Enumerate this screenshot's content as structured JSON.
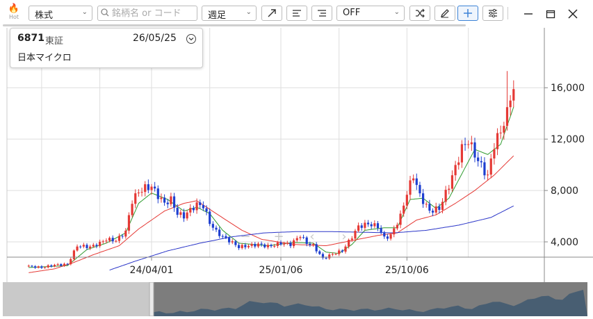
{
  "toolbar": {
    "hot_label": "Hot",
    "market_select": "株式",
    "search_placeholder": "銘柄名 or コード",
    "period_select": "週足",
    "mode_select": "OFF"
  },
  "stock": {
    "code": "6871",
    "exchange": "東証",
    "date": "26/05/25",
    "name": "日本マイクロ"
  },
  "chart_data": {
    "type": "candlestick",
    "title": "",
    "xlabel": "",
    "ylabel": "",
    "ylim": [
      1500,
      17500
    ],
    "y_ticks": [
      4000,
      8000,
      12000,
      16000
    ],
    "y_tick_labels": [
      "4,000",
      "8,000",
      "12,000",
      "16,000"
    ],
    "x_tick_labels": [
      "24/04/01",
      "25/01/06",
      "25/10/06"
    ],
    "x_tick_weeks": [
      0,
      40,
      79
    ],
    "grid": true,
    "up_color": "#e53935",
    "down_color": "#1e3fd0",
    "ma_series": [
      {
        "color": "#2e9b2e"
      },
      {
        "color": "#e53935"
      },
      {
        "color": "#2a35c8"
      }
    ],
    "anchors": [
      [
        -38,
        2100
      ],
      [
        -34,
        2000
      ],
      [
        -30,
        2200
      ],
      [
        -26,
        2250
      ],
      [
        -23,
        3700
      ],
      [
        -19,
        3600
      ],
      [
        -16,
        3900
      ],
      [
        -14,
        4200
      ],
      [
        -11,
        4100
      ],
      [
        -8,
        4800
      ],
      [
        -6,
        7200
      ],
      [
        -4,
        7900
      ],
      [
        -2,
        8200
      ],
      [
        0,
        8300
      ],
      [
        2,
        7600
      ],
      [
        4,
        7000
      ],
      [
        6,
        7300
      ],
      [
        8,
        6200
      ],
      [
        10,
        6000
      ],
      [
        12,
        6500
      ],
      [
        14,
        6900
      ],
      [
        16,
        6800
      ],
      [
        18,
        5500
      ],
      [
        20,
        4800
      ],
      [
        22,
        4400
      ],
      [
        24,
        4100
      ],
      [
        27,
        3600
      ],
      [
        30,
        3700
      ],
      [
        33,
        3800
      ],
      [
        36,
        3650
      ],
      [
        38,
        3750
      ],
      [
        40,
        3900
      ],
      [
        43,
        3800
      ],
      [
        46,
        4500
      ],
      [
        48,
        3900
      ],
      [
        50,
        3700
      ],
      [
        53,
        2700
      ],
      [
        56,
        3050
      ],
      [
        59,
        3300
      ],
      [
        62,
        4400
      ],
      [
        64,
        5200
      ],
      [
        67,
        5400
      ],
      [
        70,
        5200
      ],
      [
        72,
        4300
      ],
      [
        74,
        4500
      ],
      [
        77,
        6000
      ],
      [
        79,
        7800
      ],
      [
        81,
        9200
      ],
      [
        83,
        7600
      ],
      [
        86,
        6400
      ],
      [
        89,
        6600
      ],
      [
        92,
        8400
      ],
      [
        94,
        9800
      ],
      [
        96,
        11300
      ],
      [
        98,
        11900
      ],
      [
        100,
        10800
      ],
      [
        102,
        9900
      ],
      [
        104,
        9100
      ],
      [
        106,
        11600
      ],
      [
        108,
        12600
      ],
      [
        110,
        14000
      ],
      [
        111,
        15400
      ],
      [
        112,
        15900
      ]
    ],
    "ma_short_anchors": [
      [
        -38,
        2000
      ],
      [
        -26,
        2150
      ],
      [
        -20,
        3400
      ],
      [
        -14,
        3900
      ],
      [
        -8,
        4700
      ],
      [
        -4,
        7000
      ],
      [
        0,
        7800
      ],
      [
        5,
        7300
      ],
      [
        10,
        6400
      ],
      [
        14,
        6700
      ],
      [
        18,
        6200
      ],
      [
        22,
        4900
      ],
      [
        27,
        3900
      ],
      [
        36,
        3700
      ],
      [
        44,
        3950
      ],
      [
        50,
        3900
      ],
      [
        54,
        3200
      ],
      [
        58,
        3100
      ],
      [
        62,
        3800
      ],
      [
        66,
        4900
      ],
      [
        72,
        5100
      ],
      [
        76,
        5100
      ],
      [
        80,
        7300
      ],
      [
        84,
        7400
      ],
      [
        88,
        6600
      ],
      [
        92,
        7400
      ],
      [
        96,
        9300
      ],
      [
        100,
        11200
      ],
      [
        104,
        10800
      ],
      [
        108,
        11600
      ],
      [
        112,
        14500
      ]
    ],
    "ma_mid_anchors": [
      [
        -38,
        1600
      ],
      [
        -30,
        1900
      ],
      [
        -24,
        2400
      ],
      [
        -18,
        3000
      ],
      [
        -10,
        3700
      ],
      [
        -4,
        5000
      ],
      [
        4,
        6400
      ],
      [
        10,
        7000
      ],
      [
        14,
        7200
      ],
      [
        20,
        6200
      ],
      [
        28,
        4900
      ],
      [
        34,
        4200
      ],
      [
        44,
        3800
      ],
      [
        54,
        3700
      ],
      [
        62,
        4100
      ],
      [
        70,
        4500
      ],
      [
        76,
        4700
      ],
      [
        82,
        5700
      ],
      [
        88,
        6100
      ],
      [
        94,
        7000
      ],
      [
        100,
        8000
      ],
      [
        106,
        9200
      ],
      [
        112,
        10700
      ]
    ],
    "ma_long_anchors": [
      [
        -13,
        1800
      ],
      [
        -5,
        2500
      ],
      [
        5,
        3300
      ],
      [
        15,
        3900
      ],
      [
        25,
        4400
      ],
      [
        35,
        4700
      ],
      [
        45,
        4800
      ],
      [
        55,
        4800
      ],
      [
        65,
        4750
      ],
      [
        75,
        4700
      ],
      [
        85,
        4900
      ],
      [
        95,
        5300
      ],
      [
        105,
        5900
      ],
      [
        112,
        6800
      ]
    ]
  }
}
